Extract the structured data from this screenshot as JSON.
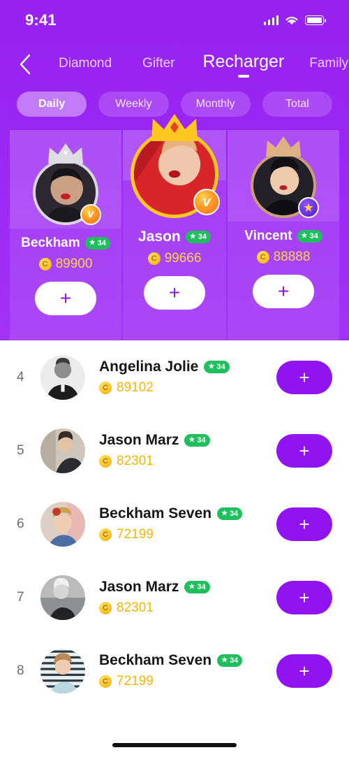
{
  "status_bar": {
    "time": "9:41",
    "signal_icon": "signal-bars-icon",
    "wifi_icon": "wifi-icon",
    "battery_icon": "battery-icon"
  },
  "nav": {
    "back_icon": "back-chevron-icon",
    "items": [
      {
        "label": "Diamond",
        "active": false
      },
      {
        "label": "Gifter",
        "active": false
      },
      {
        "label": "Recharger",
        "active": true
      },
      {
        "label": "Family",
        "active": false
      }
    ]
  },
  "filters": [
    {
      "label": "Daily",
      "active": true
    },
    {
      "label": "Weekly",
      "active": false
    },
    {
      "label": "Monthly",
      "active": false
    },
    {
      "label": "Total",
      "active": false
    }
  ],
  "podium": {
    "add_label": "+",
    "first": {
      "rank": 1,
      "name": "Jason",
      "level": "34",
      "level_star": "★",
      "coins": "99666",
      "coin_symbol": "C",
      "crown_icon": "gold-crown-icon",
      "badge_icon": "verified-v-badge-icon",
      "badge_glyph": "v"
    },
    "second": {
      "rank": 2,
      "name": "Beckham",
      "level": "34",
      "level_star": "★",
      "coins": "89900",
      "coin_symbol": "C",
      "crown_icon": "silver-crown-icon",
      "badge_icon": "verified-v-badge-icon",
      "badge_glyph": "v"
    },
    "third": {
      "rank": 3,
      "name": "Vincent",
      "level": "34",
      "level_star": "★",
      "coins": "88888",
      "coin_symbol": "C",
      "crown_icon": "bronze-crown-icon",
      "badge_icon": "star-badge-icon",
      "badge_glyph": "★"
    }
  },
  "list": {
    "add_label": "+",
    "rows": [
      {
        "rank": "4",
        "name": "Angelina Jolie",
        "level": "34",
        "level_star": "★",
        "coins": "89102",
        "coin_symbol": "C"
      },
      {
        "rank": "5",
        "name": "Jason Marz",
        "level": "34",
        "level_star": "★",
        "coins": "82301",
        "coin_symbol": "C"
      },
      {
        "rank": "6",
        "name": "Beckham Seven",
        "level": "34",
        "level_star": "★",
        "coins": "72199",
        "coin_symbol": "C"
      },
      {
        "rank": "7",
        "name": "Jason Marz",
        "level": "34",
        "level_star": "★",
        "coins": "82301",
        "coin_symbol": "C"
      },
      {
        "rank": "8",
        "name": "Beckham Seven",
        "level": "34",
        "level_star": "★",
        "coins": "72199",
        "coin_symbol": "C"
      }
    ]
  },
  "colors": {
    "brand_purple": "#9722f0",
    "accent_purple": "#9013f0",
    "coin_gold": "#f2b705",
    "level_green": "#1fbf5e",
    "gold_crown": "#ffc71f",
    "silver_crown": "#d8d8dd",
    "bronze_crown": "#caa070"
  }
}
